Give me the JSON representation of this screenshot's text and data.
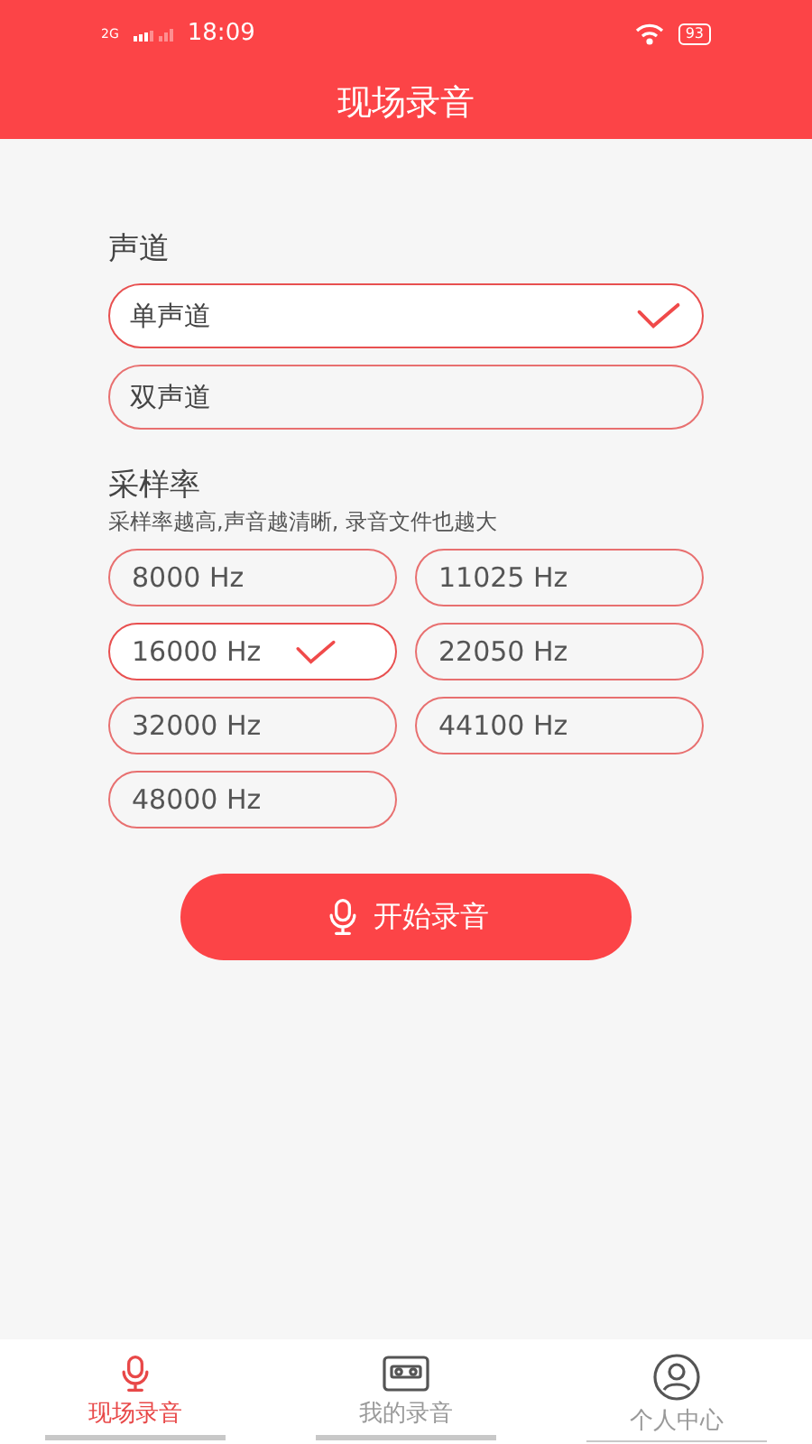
{
  "status_bar": {
    "network": "2G",
    "time": "18:09",
    "battery": "93"
  },
  "header": {
    "title": "现场录音"
  },
  "channel_section": {
    "title": "声道",
    "options": [
      {
        "label": "单声道",
        "selected": true
      },
      {
        "label": "双声道",
        "selected": false
      }
    ]
  },
  "rate_section": {
    "title": "采样率",
    "hint": "采样率越高,声音越清晰, 录音文件也越大",
    "options": [
      {
        "label": "8000 Hz",
        "selected": false
      },
      {
        "label": "11025 Hz",
        "selected": false
      },
      {
        "label": "16000 Hz",
        "selected": true
      },
      {
        "label": "22050 Hz",
        "selected": false
      },
      {
        "label": "32000 Hz",
        "selected": false
      },
      {
        "label": "44100 Hz",
        "selected": false
      },
      {
        "label": "48000 Hz",
        "selected": false
      }
    ]
  },
  "record_button": {
    "label": "开始录音"
  },
  "tab_bar": [
    {
      "label": "现场录音",
      "kind": "mic",
      "selected": true
    },
    {
      "label": "我的录音",
      "kind": "tape",
      "selected": false
    },
    {
      "label": "个人中心",
      "kind": "person",
      "selected": false
    }
  ]
}
